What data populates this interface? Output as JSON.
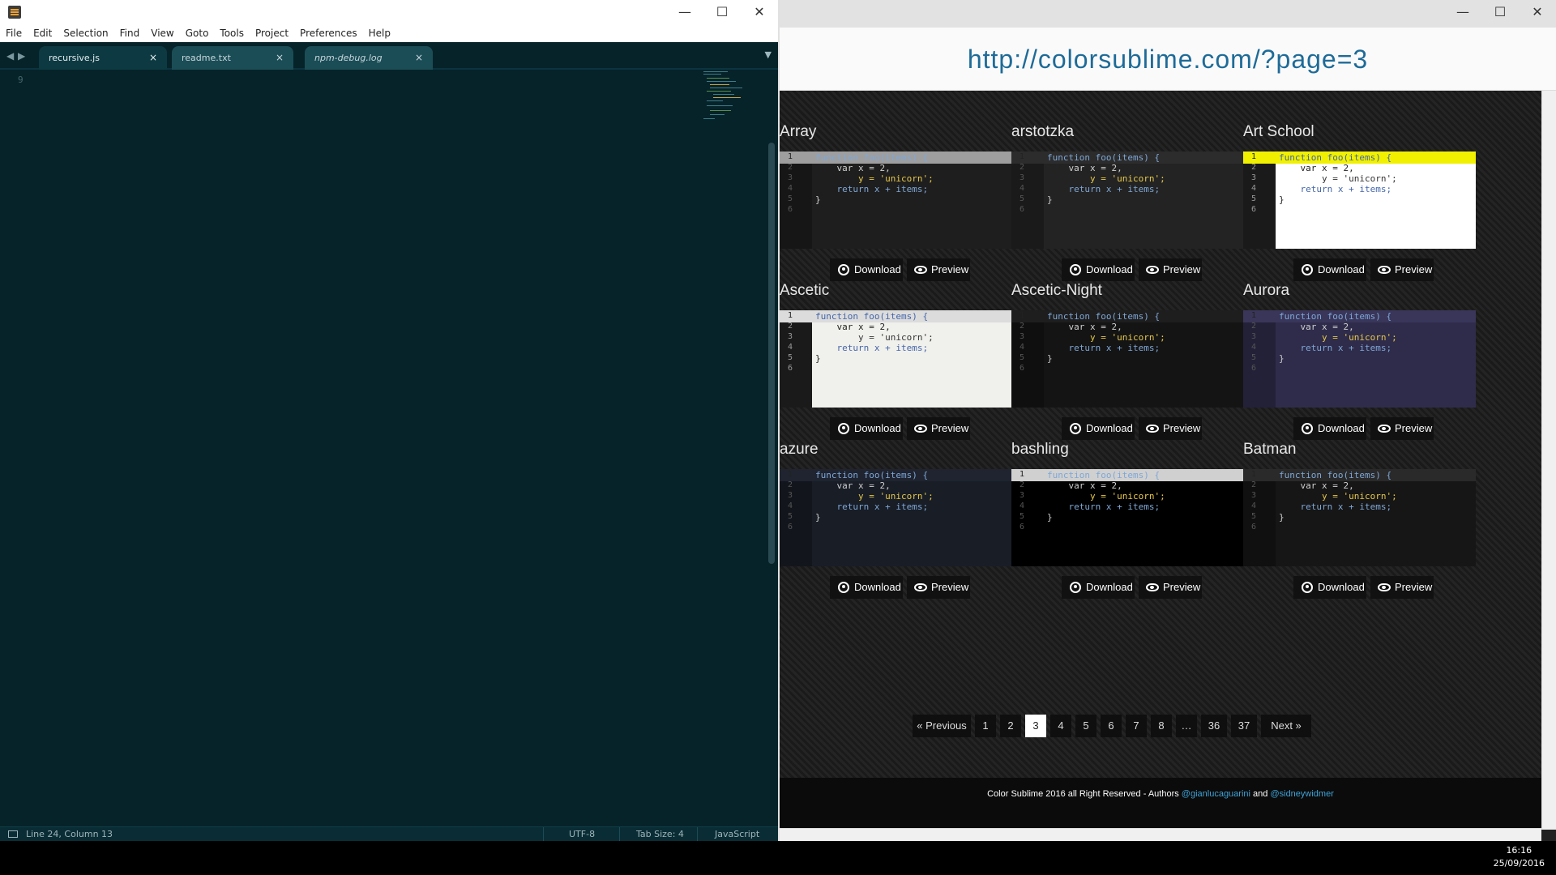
{
  "sublime": {
    "menu": [
      "File",
      "Edit",
      "Selection",
      "Find",
      "View",
      "Goto",
      "Tools",
      "Project",
      "Preferences",
      "Help"
    ],
    "tabs": [
      {
        "label": "recursive.js",
        "active": true
      },
      {
        "label": "readme.txt",
        "active": false
      },
      {
        "label": "npm-debug.log",
        "active": false
      }
    ],
    "gutter_line": "9",
    "status": {
      "position": "Line 24, Column 13",
      "encoding": "UTF-8",
      "tab_size": "Tab Size: 4",
      "syntax": "JavaScript"
    },
    "colors": {
      "background": "#062329",
      "tab_active": "#0d3a42"
    }
  },
  "browser": {
    "url": "http://colorsublime.com/?page=3",
    "download_label": "Download",
    "preview_label": "Preview",
    "themes": [
      {
        "name": "Array",
        "bg": "#1e1e1e",
        "hl": "#9e9e9e"
      },
      {
        "name": "arstotzka",
        "bg": "#232323",
        "hl": "#2c2c2c"
      },
      {
        "name": "Art School",
        "bg": "#ffffff",
        "hl": "#f0f000"
      },
      {
        "name": "Ascetic",
        "bg": "#f0f0ec",
        "hl": "#dcdcdc"
      },
      {
        "name": "Ascetic-Night",
        "bg": "#141414",
        "hl": "#1e1e1e"
      },
      {
        "name": "Aurora",
        "bg": "#2f2c4b",
        "hl": "#39365a"
      },
      {
        "name": "azure",
        "bg": "#181d26",
        "hl": "#1f2430"
      },
      {
        "name": "bashling",
        "bg": "#000000",
        "hl": "#d0d0d0"
      },
      {
        "name": "Batman",
        "bg": "#161616",
        "hl": "#2a2a2a"
      }
    ],
    "code": {
      "l1": "function foo(items) {",
      "l2": "    var x = 2,",
      "l3": "        y = 'unicorn';",
      "l4": "    return x + items;",
      "l5": "}"
    },
    "pager": [
      "« Previous",
      "1",
      "2",
      "3",
      "4",
      "5",
      "6",
      "7",
      "8",
      "…",
      "36",
      "37",
      "Next »"
    ],
    "current_page": "3",
    "footer": {
      "text": "Color Sublime 2016 all Right Reserved - Authors",
      "author1": "@gianlucaguarini",
      "and": "and",
      "author2": "@sidneywidmer"
    }
  },
  "taskbar": {
    "time": "16:16",
    "date": "25/09/2016"
  }
}
